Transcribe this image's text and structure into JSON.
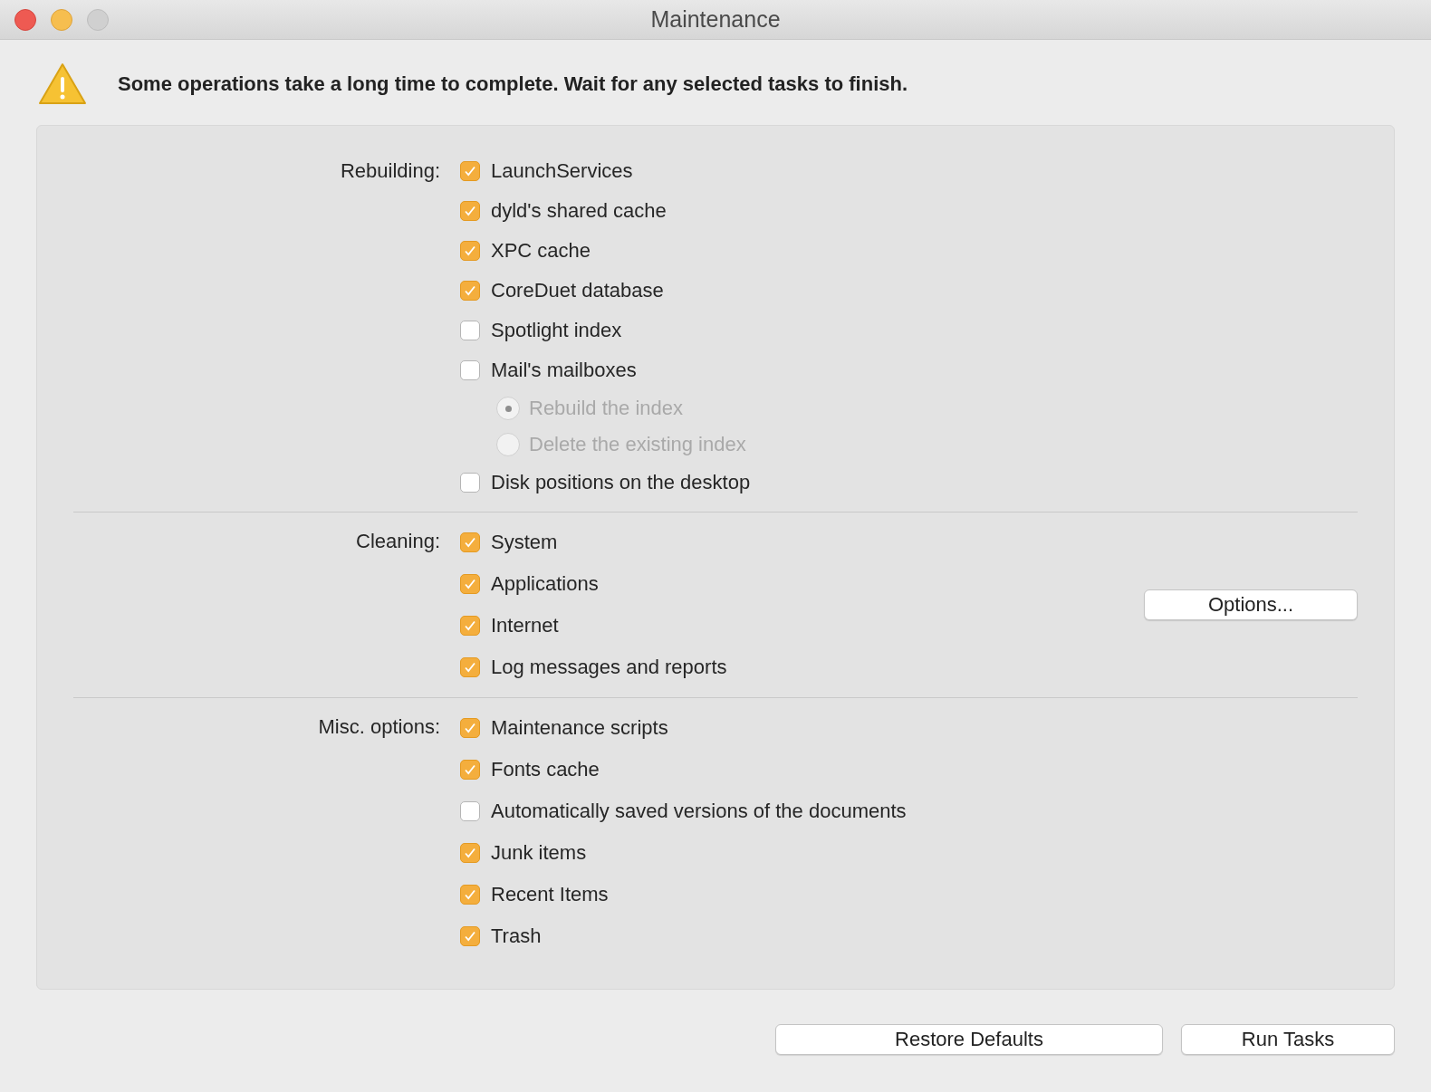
{
  "window": {
    "title": "Maintenance"
  },
  "warning": "Some operations take a long time to complete. Wait for any selected tasks to finish.",
  "sections": [
    {
      "label": "Rebuilding:",
      "items": [
        {
          "label": "LaunchServices",
          "checked": true
        },
        {
          "label": "dyld's shared cache",
          "checked": true
        },
        {
          "label": "XPC cache",
          "checked": true
        },
        {
          "label": "CoreDuet database",
          "checked": true
        },
        {
          "label": "Spotlight index",
          "checked": false
        },
        {
          "label": "Mail's mailboxes",
          "checked": false,
          "options": [
            {
              "label": "Rebuild the index",
              "selected": true,
              "disabled": true
            },
            {
              "label": "Delete the existing index",
              "selected": false,
              "disabled": true
            }
          ]
        },
        {
          "label": "Disk positions on the desktop",
          "checked": false
        }
      ]
    },
    {
      "label": "Cleaning:",
      "button": "Options...",
      "items": [
        {
          "label": "System",
          "checked": true
        },
        {
          "label": "Applications",
          "checked": true
        },
        {
          "label": "Internet",
          "checked": true
        },
        {
          "label": "Log messages and reports",
          "checked": true
        }
      ]
    },
    {
      "label": "Misc. options:",
      "items": [
        {
          "label": "Maintenance scripts",
          "checked": true
        },
        {
          "label": "Fonts cache",
          "checked": true
        },
        {
          "label": "Automatically saved versions of the documents",
          "checked": false
        },
        {
          "label": "Junk items",
          "checked": true
        },
        {
          "label": "Recent Items",
          "checked": true
        },
        {
          "label": "Trash",
          "checked": true
        }
      ]
    }
  ],
  "buttons": [
    "Restore Defaults",
    "Run Tasks"
  ]
}
